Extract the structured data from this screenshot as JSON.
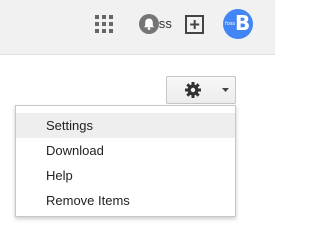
{
  "header": {
    "username": "+foss",
    "avatar": {
      "letter": "B",
      "small_text": "foss",
      "color": "#4285f4"
    },
    "icons": [
      "apps-icon",
      "notifications-icon",
      "share-icon"
    ]
  },
  "toolbar": {
    "settings_button": {
      "icon": "gear-icon",
      "caret": "chevron-down-icon"
    }
  },
  "menu": {
    "items": [
      {
        "label": "Settings",
        "highlighted": true
      },
      {
        "label": "Download"
      },
      {
        "label": "Help"
      },
      {
        "label": "Remove Items"
      }
    ]
  }
}
